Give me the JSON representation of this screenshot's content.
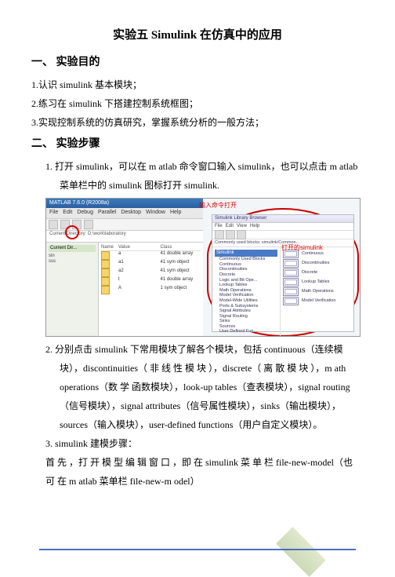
{
  "doc": {
    "title": "实验五    Simulink 在仿真中的应用",
    "section1_heading": "一、    实验目的",
    "s1_item1": "1.认识 simulink 基本模块；",
    "s1_item2": "2.练习在 simulink 下搭建控制系统框图；",
    "s1_item3": "3.实现控制系统的仿真研究，掌握系统分析的一般方法；",
    "section2_heading": "二、    实验步骤",
    "s2_item1": "1.  打开 simulink，可以在 m atlab 命令窗口输入 simulink，也可以点击 m atlab 菜单栏中的 simulink 图标打开 simulink.",
    "s2_item2": "2.  分别点击 simulink 下常用模块了解各个模块，包括 continuous（连续模块），discontinuities（ 非 线 性 模 块 ），discrete（ 离 散 模 块 ），m ath operations（数 学 函数模块），look-up tables（查表模块），signal routing（信号模块），signal attributes（信号属性模块），sinks（输出模块），sources（输入模块），user-defined functions（用户自定义模块）。",
    "s2_item3": "3.  simulink 建模步骤：",
    "s2_item3_cont": "首 先 ，打 开 模 型 编 辑 窗 口 ，即 在 simulink 菜 单 栏 file-new-model（也 可 在 m atlab 菜单栏 file-new-m odel）"
  },
  "matlab": {
    "title": "MATLAB 7.6.0 (R2008a)",
    "menu": [
      "File",
      "Edit",
      "Debug",
      "Parallel",
      "Desktop",
      "Window",
      "Help"
    ],
    "dir_label": "Current Directory:",
    "dir_value": "D:\\work\\laboratory",
    "side_title": "Current Dir...",
    "files": [
      "sin",
      "sss"
    ],
    "workspace_header": [
      "Name",
      "Value",
      "Class"
    ],
    "workspace_rows": [
      {
        "name": "a",
        "value": "41 double array",
        "class": ""
      },
      {
        "name": "a1",
        "value": "41 sym object",
        "class": ""
      },
      {
        "name": "a2",
        "value": "41 sym object",
        "class": ""
      },
      {
        "name": "t",
        "value": "41 double array",
        "class": ""
      },
      {
        "name": "A",
        "value": "1 sym object",
        "class": ""
      }
    ]
  },
  "simulink": {
    "title": "Simulink Library Browser",
    "menu": [
      "File",
      "Edit",
      "View",
      "Help"
    ],
    "search_placeholder": "Commonly used blocks: simulink/Common...",
    "tree_root": "Simulink",
    "tree_items": [
      "Commonly Used Blocks",
      "Continuous",
      "Discontinuities",
      "Discrete",
      "Logic and Bit Ope...",
      "Lookup Tables",
      "Math Operations",
      "Model Verification",
      "Model-Wide Utilities",
      "Ports & Subsystems",
      "Signal Attributes",
      "Signal Routing",
      "Sinks",
      "Sources",
      "User-Defined Fun..."
    ],
    "list": [
      "Continuous",
      "Discontinuities",
      "Discrete",
      "Lookup Tables",
      "Math Operations",
      "Model Verification"
    ]
  },
  "annotations": {
    "red1": "输入命令打开",
    "red2": "打开的simulink"
  }
}
